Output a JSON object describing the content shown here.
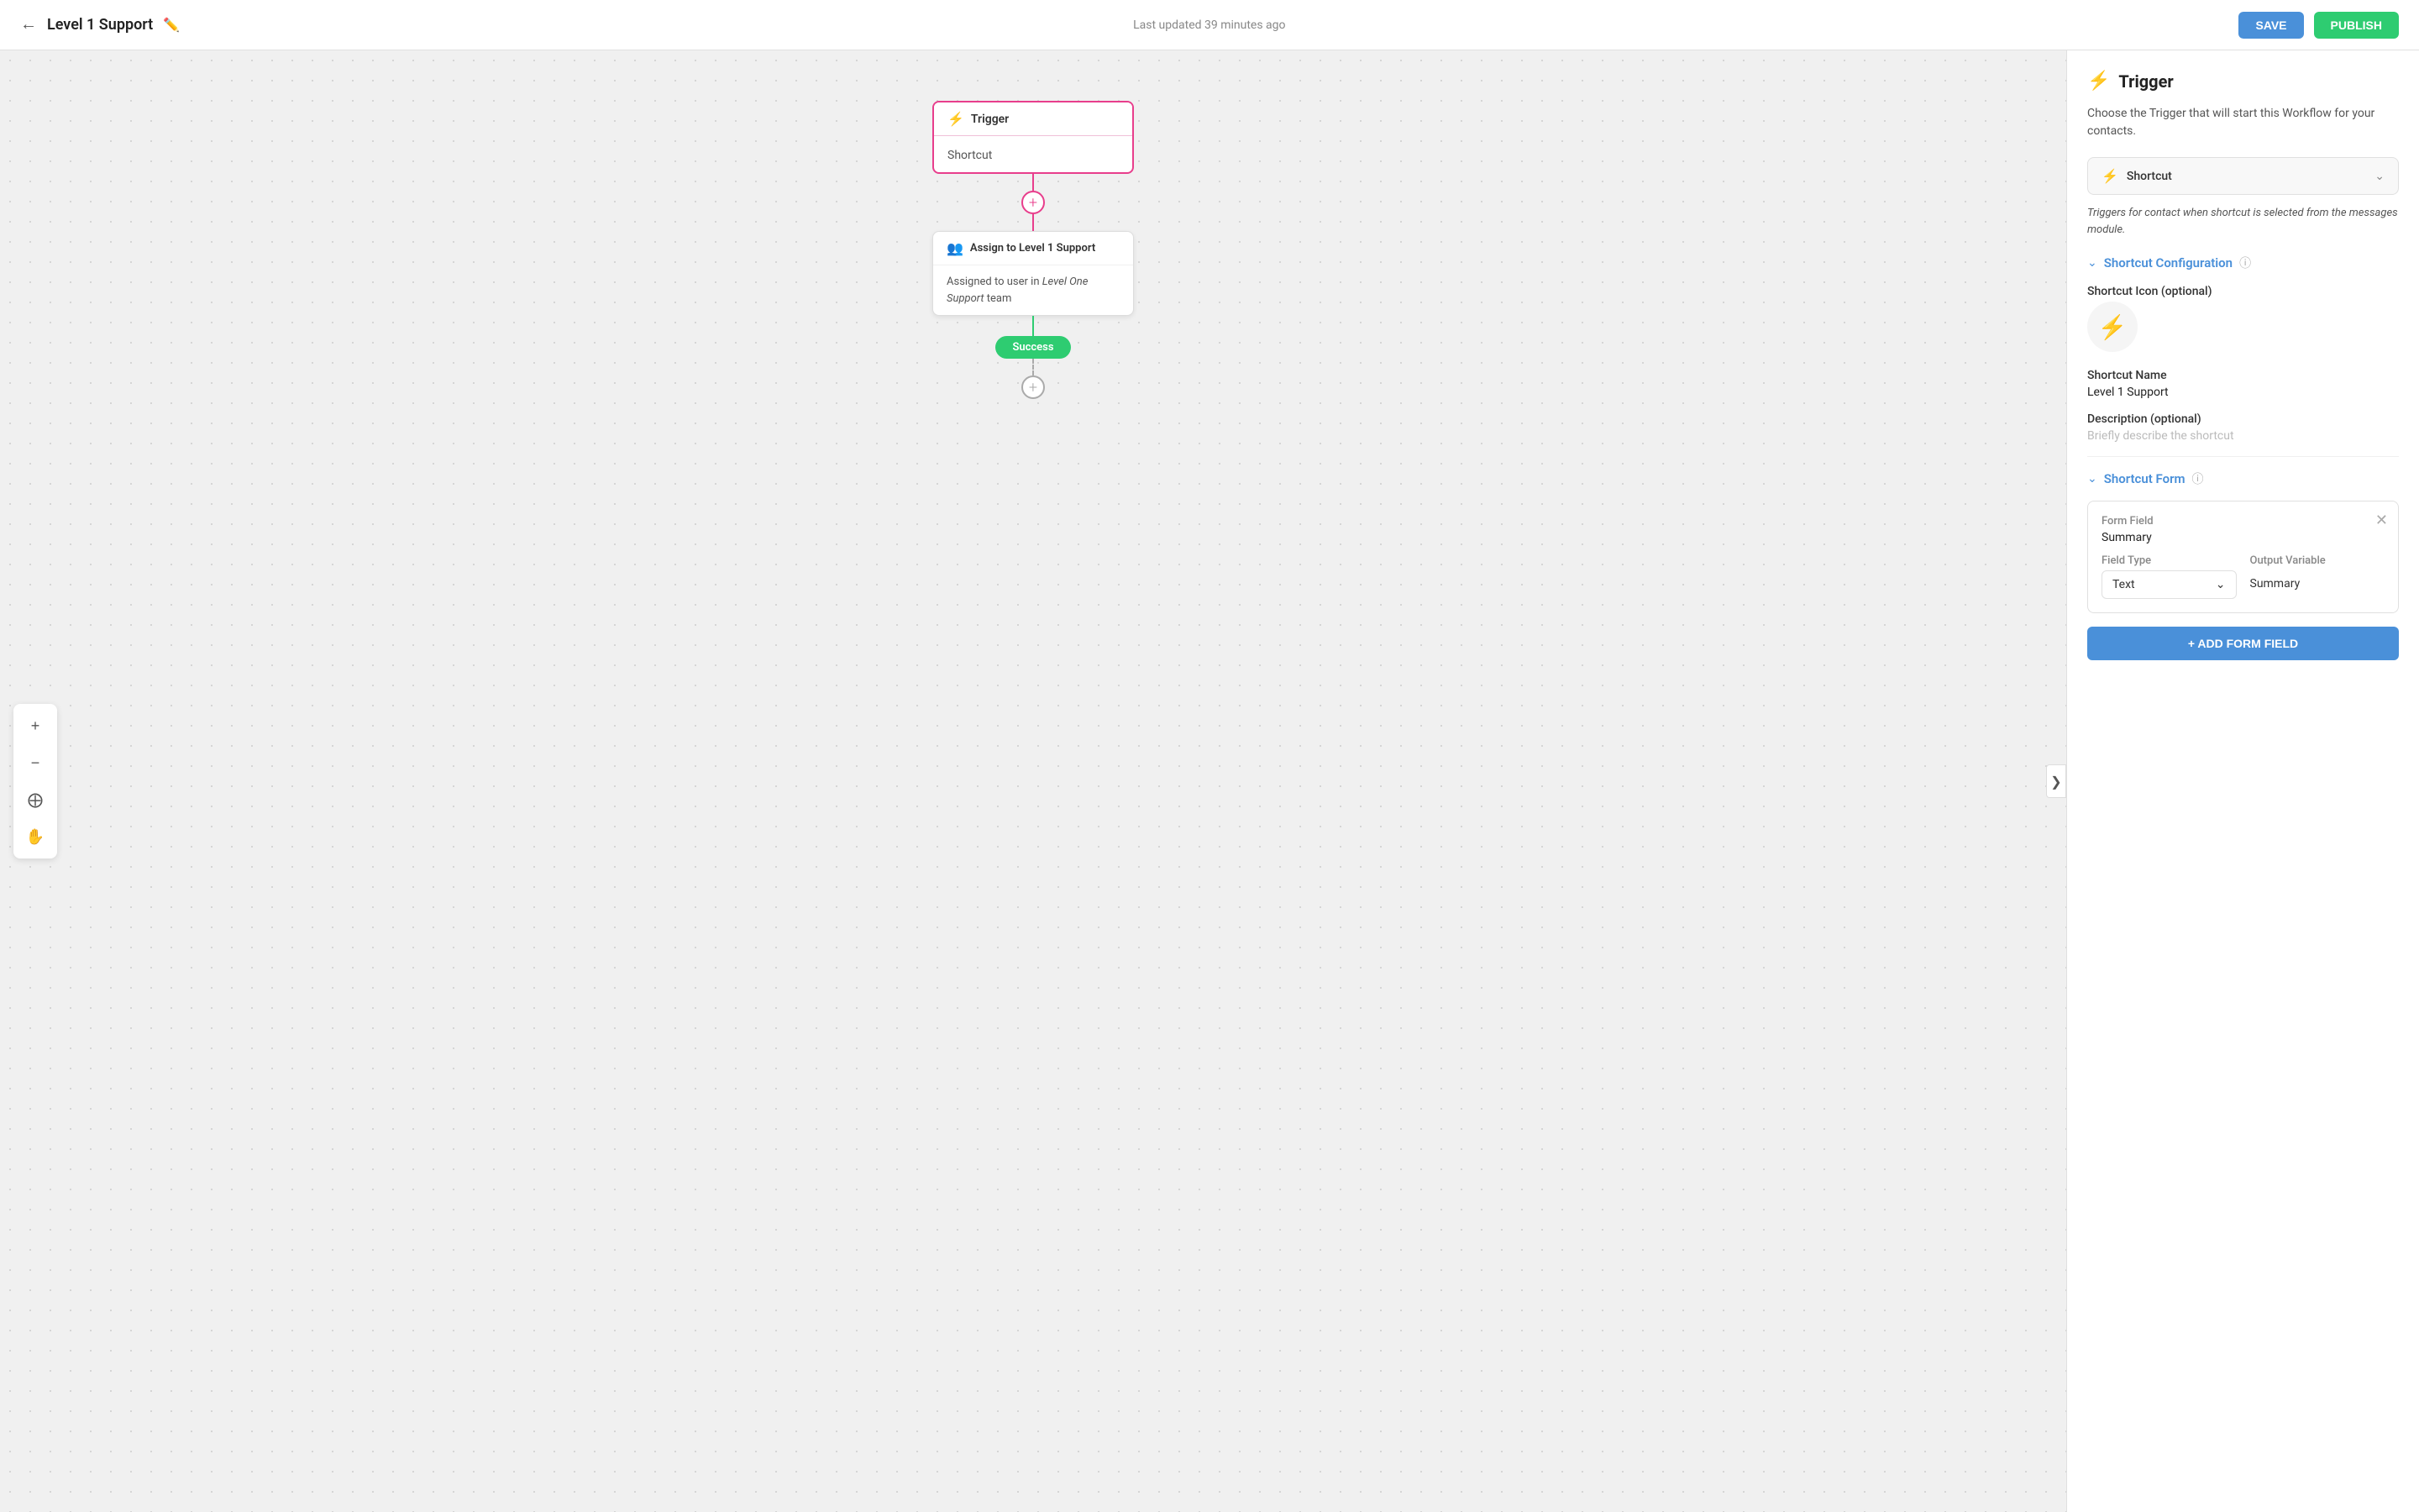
{
  "header": {
    "title": "Level 1 Support",
    "last_updated": "Last updated 39 minutes ago",
    "save_label": "SAVE",
    "publish_label": "PUBLISH"
  },
  "toolbar": {
    "zoom_in": "+",
    "zoom_out": "−",
    "fit": "⊕",
    "pan": "✋"
  },
  "canvas": {
    "collapse_arrow": "❯"
  },
  "trigger_node": {
    "header_label": "Trigger",
    "body_label": "Shortcut"
  },
  "assign_node": {
    "header_label": "Assign to Level 1 Support",
    "body_line1": "Assigned to user in ",
    "body_italic": "Level One Support",
    "body_line2": " team"
  },
  "success_badge": {
    "label": "Success"
  },
  "right_panel": {
    "title": "Trigger",
    "description": "Choose the Trigger that will start this Workflow for your contacts.",
    "trigger_dropdown": {
      "label": "Shortcut"
    },
    "trigger_hint": "Triggers for contact when shortcut is selected from the messages module.",
    "shortcut_config": {
      "section_label": "Shortcut Configuration",
      "icon_label": "Shortcut Icon (optional)",
      "name_label": "Shortcut Name",
      "name_value": "Level 1 Support",
      "description_label": "Description (optional)",
      "description_placeholder": "Briefly describe the shortcut"
    },
    "shortcut_form": {
      "section_label": "Shortcut Form",
      "form_field_label": "Form Field",
      "form_field_value": "Summary",
      "field_type_label": "Field Type",
      "field_type_value": "Text",
      "output_variable_label": "Output Variable",
      "output_variable_value": "Summary"
    },
    "add_form_field_btn": "+ ADD FORM FIELD"
  }
}
